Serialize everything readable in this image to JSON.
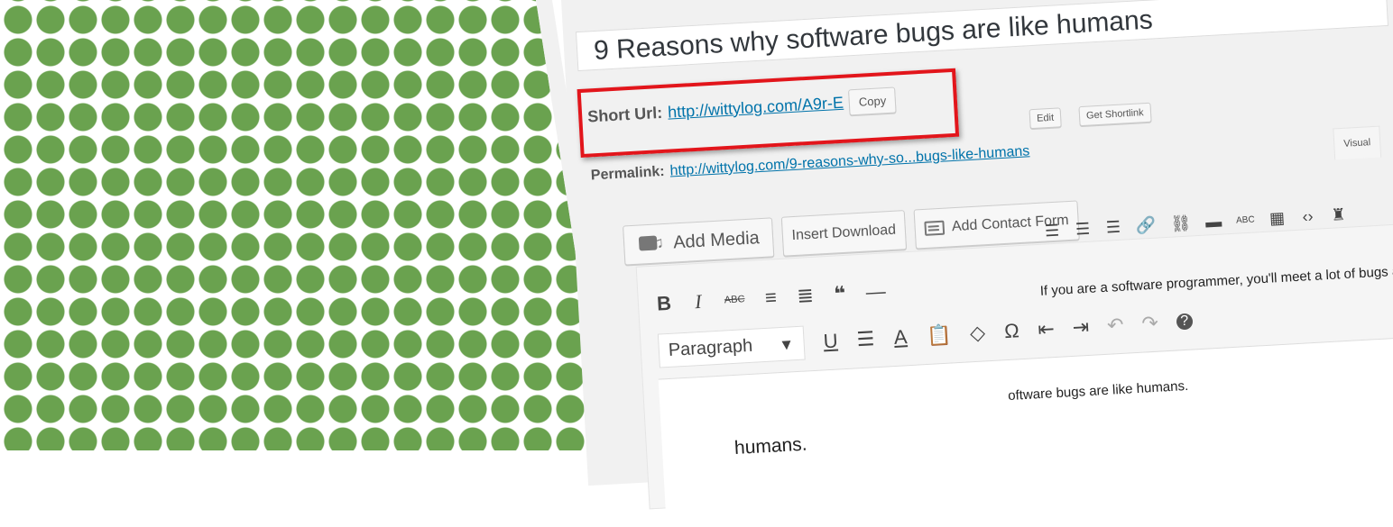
{
  "post_title": "9 Reasons why software bugs are like humans",
  "short_url": {
    "label": "Short Url:",
    "url": "http://wittylog.com/A9r-E",
    "copy_button": "Copy"
  },
  "permalink": {
    "label": "Permalink:",
    "url": "http://wittylog.com/9-reasons-why-so...bugs-like-humans",
    "edit_button": "Edit",
    "shortlink_button": "Get Shortlink"
  },
  "editor_tabs": {
    "visual": "Visual"
  },
  "media_buttons": {
    "add_media": "Add Media",
    "insert_download": "Insert Download",
    "add_contact_form": "Add Contact Form"
  },
  "toolbar": {
    "format_select": "Paragraph",
    "bold": "B",
    "italic": "I",
    "strike": "ABC",
    "underline": "U",
    "font_color": "A",
    "omega": "Ω",
    "help": "?",
    "spellcheck": "ABC"
  },
  "content": {
    "line1": "If you are a software programmer, you'll meet a lot of bugs all along. The funny part is the behavior of software b",
    "line2": "oftware bugs are like humans.",
    "line3": "humans."
  },
  "colors": {
    "pattern_green": "#6aa24f",
    "highlight_red": "#e2151b",
    "link_blue": "#0073aa"
  }
}
